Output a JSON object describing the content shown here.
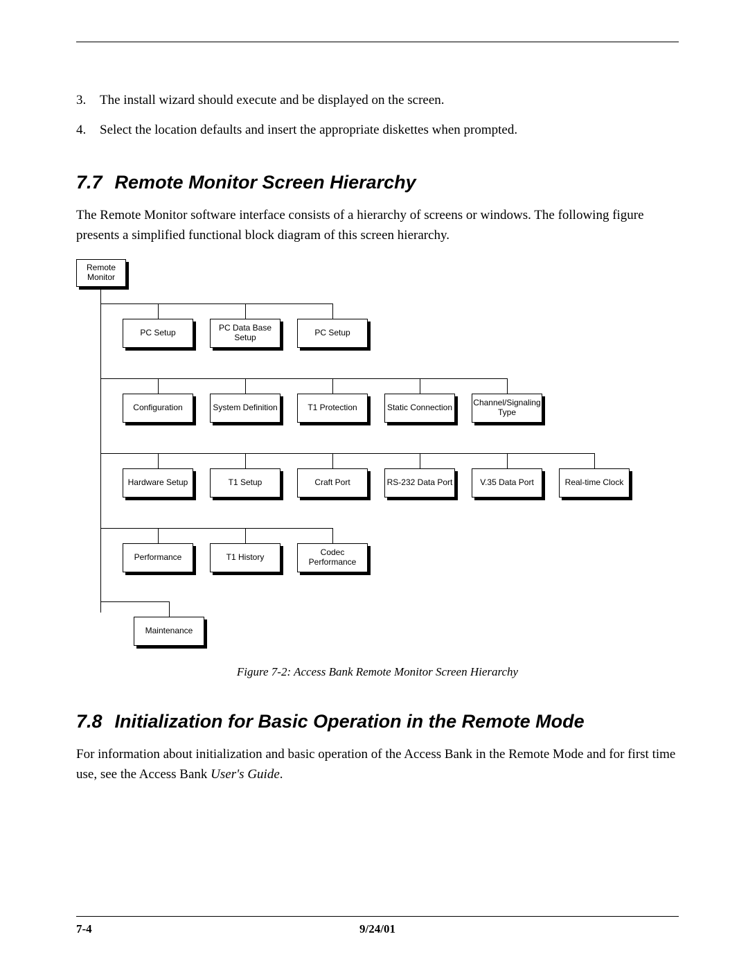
{
  "list": {
    "item3_num": "3.",
    "item3_text": "The install wizard should execute and be displayed on the screen.",
    "item4_num": "4.",
    "item4_text": "Select the location defaults and insert the appropriate diskettes when prompted."
  },
  "sec77_num": "7.7",
  "sec77_title": "Remote Monitor Screen Hierarchy",
  "sec77_body": "The Remote Monitor software interface consists of a hierarchy of screens or windows. The following figure presents a simplified functional block diagram of this screen hierarchy.",
  "diagram": {
    "root": "Remote Monitor",
    "row1": [
      "PC  Setup",
      "PC Data Base Setup",
      "PC Setup"
    ],
    "row2": [
      "Configuration",
      "System Definition",
      "T1 Protection",
      "Static Connection",
      "Channel/Signaling Type"
    ],
    "row3": [
      "Hardware Setup",
      "T1 Setup",
      "Craft Port",
      "RS-232 Data Port",
      "V.35 Data Port",
      "Real-time Clock"
    ],
    "row4": [
      "Performance",
      "T1 History",
      "Codec Performance"
    ],
    "row5": [
      "Maintenance"
    ]
  },
  "fig_caption": "Figure 7-2: Access Bank Remote Monitor Screen Hierarchy",
  "sec78_num": "7.8",
  "sec78_title": "Initialization for Basic Operation in the Remote Mode",
  "sec78_body_a": "For information about initialization and basic operation of the Access Bank in the Remote Mode and for first time use, see the Access Bank ",
  "sec78_body_b": "User's Guide",
  "sec78_body_c": ".",
  "footer": {
    "page": "7-4",
    "date": "9/24/01"
  }
}
